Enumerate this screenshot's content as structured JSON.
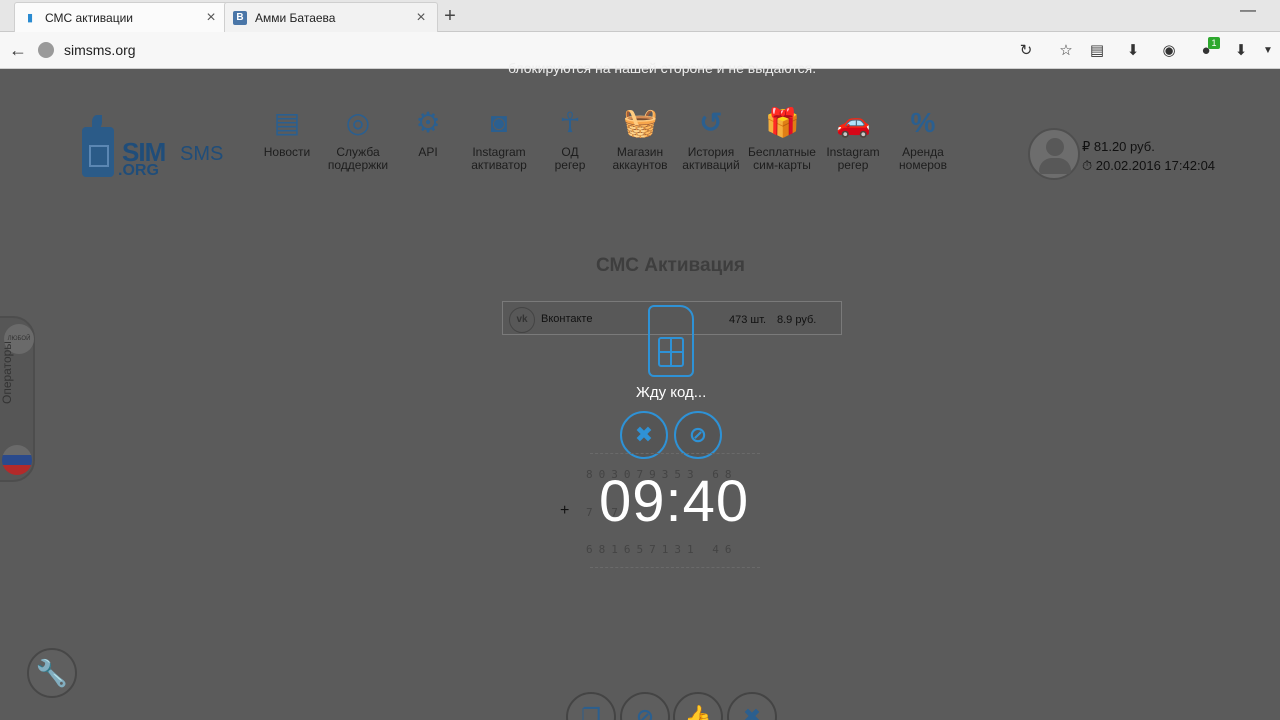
{
  "browser": {
    "tabs": [
      {
        "title": "СМС активации",
        "icon": "simsms-favicon"
      },
      {
        "title": "Амми Батаева",
        "icon": "vk-favicon"
      }
    ],
    "new_tab": "+",
    "minimize": "—",
    "url": "simsms.org",
    "notification_count": "1"
  },
  "page": {
    "notice": "блокируются на нашей стороне и не выдаются.",
    "logo": {
      "sim": "SIM",
      "sms": "SMS",
      "org": ".ORG"
    },
    "nav": [
      {
        "label1": "Новости",
        "label2": "",
        "icon": "newspaper-icon",
        "glyph": "▤"
      },
      {
        "label1": "Служба",
        "label2": "поддержки",
        "icon": "lifebuoy-icon",
        "glyph": "◎"
      },
      {
        "label1": "API",
        "label2": "",
        "icon": "gears-icon",
        "glyph": "⚙"
      },
      {
        "label1": "Instagram",
        "label2": "активатор",
        "icon": "instagram-icon",
        "glyph": "◙"
      },
      {
        "label1": "ОД",
        "label2": "регер",
        "icon": "odnoklassniki-icon",
        "glyph": "☥"
      },
      {
        "label1": "Магазин",
        "label2": "аккаунтов",
        "icon": "basket-icon",
        "glyph": "🧺"
      },
      {
        "label1": "История",
        "label2": "активаций",
        "icon": "history-icon",
        "glyph": "↺"
      },
      {
        "label1": "Бесплатные",
        "label2": "сим-карты",
        "icon": "gift-icon",
        "glyph": "🎁"
      },
      {
        "label1": "Instagram",
        "label2": "регер",
        "icon": "car-icon",
        "glyph": "🚗"
      },
      {
        "label1": "Аренда",
        "label2": "номеров",
        "icon": "percent-icon",
        "glyph": "%"
      }
    ],
    "user": {
      "balance": "₽ 81.20 руб.",
      "datetime": "⏱ 20.02.2016 17:42:04"
    },
    "heading": "СМС Активация",
    "service": {
      "icon_text": "vk",
      "name": "Вконтакте",
      "qty": "473 шт.",
      "price": "8.9 руб."
    },
    "status": "Жду код...",
    "digits_row1": "803079353 68",
    "digits_row2": "7         7",
    "digits_row3": "681657131 46",
    "plus": "+",
    "timer": "09:40",
    "side": {
      "any_label": "ЛЮБОЙ",
      "operators_label": "Операторы"
    }
  }
}
